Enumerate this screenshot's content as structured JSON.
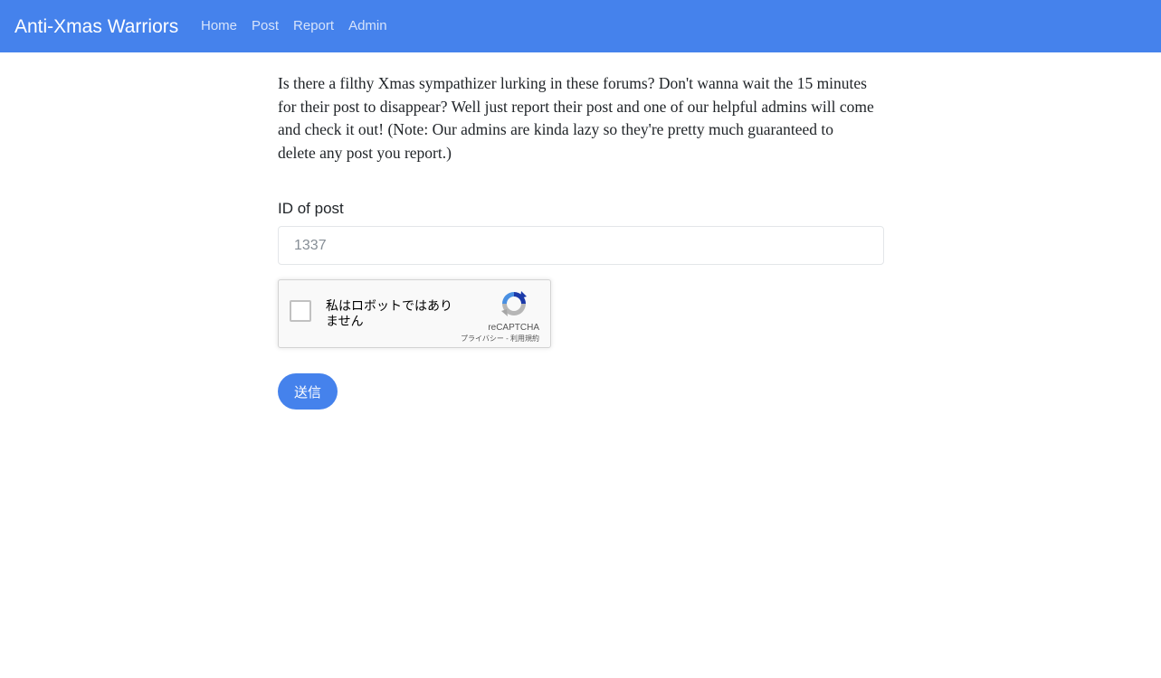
{
  "navbar": {
    "brand": "Anti-Xmas Warriors",
    "links": [
      {
        "label": "Home"
      },
      {
        "label": "Post"
      },
      {
        "label": "Report"
      },
      {
        "label": "Admin"
      }
    ],
    "background_color": "#4582ec"
  },
  "main": {
    "intro": "Is there a filthy Xmas sympathizer lurking in these forums? Don't wanna wait the 15 minutes for their post to disappear? Well just report their post and one of our helpful admins will come and check it out! (Note: Our admins are kinda lazy so they're pretty much guaranteed to delete any post you report.)",
    "form": {
      "id_label": "ID of post",
      "id_placeholder": "1337",
      "id_value": "",
      "submit_label": "送信"
    },
    "recaptcha": {
      "checkbox_label": "私はロボットではありません",
      "brand": "reCAPTCHA",
      "privacy_link": "プライバシー",
      "separator": " - ",
      "terms_link": "利用規約",
      "logo_icon": "recaptcha-logo-icon",
      "checked": false
    }
  }
}
